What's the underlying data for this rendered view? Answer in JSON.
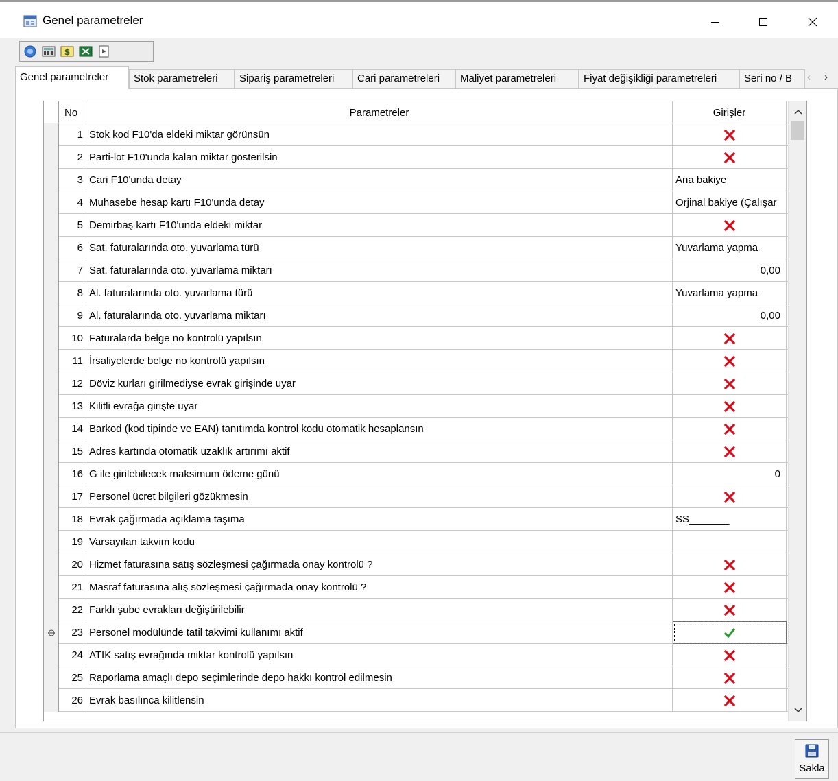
{
  "window": {
    "title": "Genel parametreler",
    "colors": {
      "check_no": "#e81123",
      "check_yes": "#2d9b2d",
      "accent": "#1f5fbf"
    }
  },
  "toolbar": {
    "buttons": [
      "help-icon",
      "calculator-icon",
      "currency-icon",
      "excel-icon",
      "exit-icon"
    ]
  },
  "tabs": [
    {
      "label": "Genel parametreler",
      "active": true
    },
    {
      "label": "Stok parametreleri",
      "active": false
    },
    {
      "label": "Sipariş parametreleri",
      "active": false
    },
    {
      "label": "Cari parametreleri",
      "active": false
    },
    {
      "label": "Maliyet parametreleri",
      "active": false
    },
    {
      "label": "Fiyat değişikliği parametreleri",
      "active": false
    },
    {
      "label": "Seri no / B",
      "active": false
    }
  ],
  "grid": {
    "headers": {
      "no": "No",
      "param": "Parametreler",
      "value": "Girişler"
    },
    "rows": [
      {
        "no": "1",
        "param": "Stok kod F10'da eldeki miktar görünsün",
        "kind": "check",
        "value": false
      },
      {
        "no": "2",
        "param": "Parti-lot F10'unda kalan miktar gösterilsin",
        "kind": "check",
        "value": false
      },
      {
        "no": "3",
        "param": "Cari F10'unda detay",
        "kind": "text",
        "value": "Ana bakiye"
      },
      {
        "no": "4",
        "param": "Muhasebe hesap kartı F10'unda detay",
        "kind": "text",
        "value": "Orjinal bakiye (Çalışar"
      },
      {
        "no": "5",
        "param": "Demirbaş kartı F10'unda eldeki miktar",
        "kind": "check",
        "value": false
      },
      {
        "no": "6",
        "param": "Sat. faturalarında oto. yuvarlama türü",
        "kind": "text",
        "value": "Yuvarlama yapma"
      },
      {
        "no": "7",
        "param": "Sat. faturalarında oto. yuvarlama miktarı",
        "kind": "num",
        "value": "0,00"
      },
      {
        "no": "8",
        "param": "Al. faturalarında oto. yuvarlama türü",
        "kind": "text",
        "value": "Yuvarlama yapma"
      },
      {
        "no": "9",
        "param": "Al. faturalarında oto. yuvarlama miktarı",
        "kind": "num",
        "value": "0,00"
      },
      {
        "no": "10",
        "param": "Faturalarda belge no kontrolü yapılsın",
        "kind": "check",
        "value": false
      },
      {
        "no": "11",
        "param": "İrsaliyelerde belge no kontrolü yapılsın",
        "kind": "check",
        "value": false
      },
      {
        "no": "12",
        "param": "Döviz kurları girilmediyse evrak girişinde uyar",
        "kind": "check",
        "value": false
      },
      {
        "no": "13",
        "param": "Kilitli evrağa girişte uyar",
        "kind": "check",
        "value": false
      },
      {
        "no": "14",
        "param": "Barkod (kod tipinde ve EAN) tanıtımda kontrol kodu otomatik hesaplansın",
        "kind": "check",
        "value": false
      },
      {
        "no": "15",
        "param": "Adres kartında otomatik uzaklık artırımı aktif",
        "kind": "check",
        "value": false
      },
      {
        "no": "16",
        "param": "G ile girilebilecek maksimum ödeme günü",
        "kind": "num",
        "value": "0"
      },
      {
        "no": "17",
        "param": "Personel ücret bilgileri gözükmesin",
        "kind": "check",
        "value": false
      },
      {
        "no": "18",
        "param": "Evrak çağırmada açıklama taşıma",
        "kind": "text",
        "value": "SS_______"
      },
      {
        "no": "19",
        "param": "Varsayılan takvim kodu",
        "kind": "text",
        "value": ""
      },
      {
        "no": "20",
        "param": "Hizmet faturasına satış sözleşmesi çağırmada onay kontrolü ?",
        "kind": "check",
        "value": false
      },
      {
        "no": "21",
        "param": "Masraf faturasına alış sözleşmesi çağırmada onay kontrolü ?",
        "kind": "check",
        "value": false
      },
      {
        "no": "22",
        "param": "Farklı şube evrakları değiştirilebilir",
        "kind": "check",
        "value": false
      },
      {
        "no": "23",
        "param": "Personel modülünde tatil takvimi kullanımı aktif",
        "kind": "check",
        "value": true,
        "current": true
      },
      {
        "no": "24",
        "param": "ATIK satış evrağında miktar kontrolü yapılsın",
        "kind": "check",
        "value": false
      },
      {
        "no": "25",
        "param": "Raporlama amaçlı depo seçimlerinde depo hakkı kontrol edilmesin",
        "kind": "check",
        "value": false
      },
      {
        "no": "26",
        "param": "Evrak basılınca kilitlensin",
        "kind": "check",
        "value": false
      }
    ]
  },
  "footer": {
    "save_label": "Sakla"
  }
}
